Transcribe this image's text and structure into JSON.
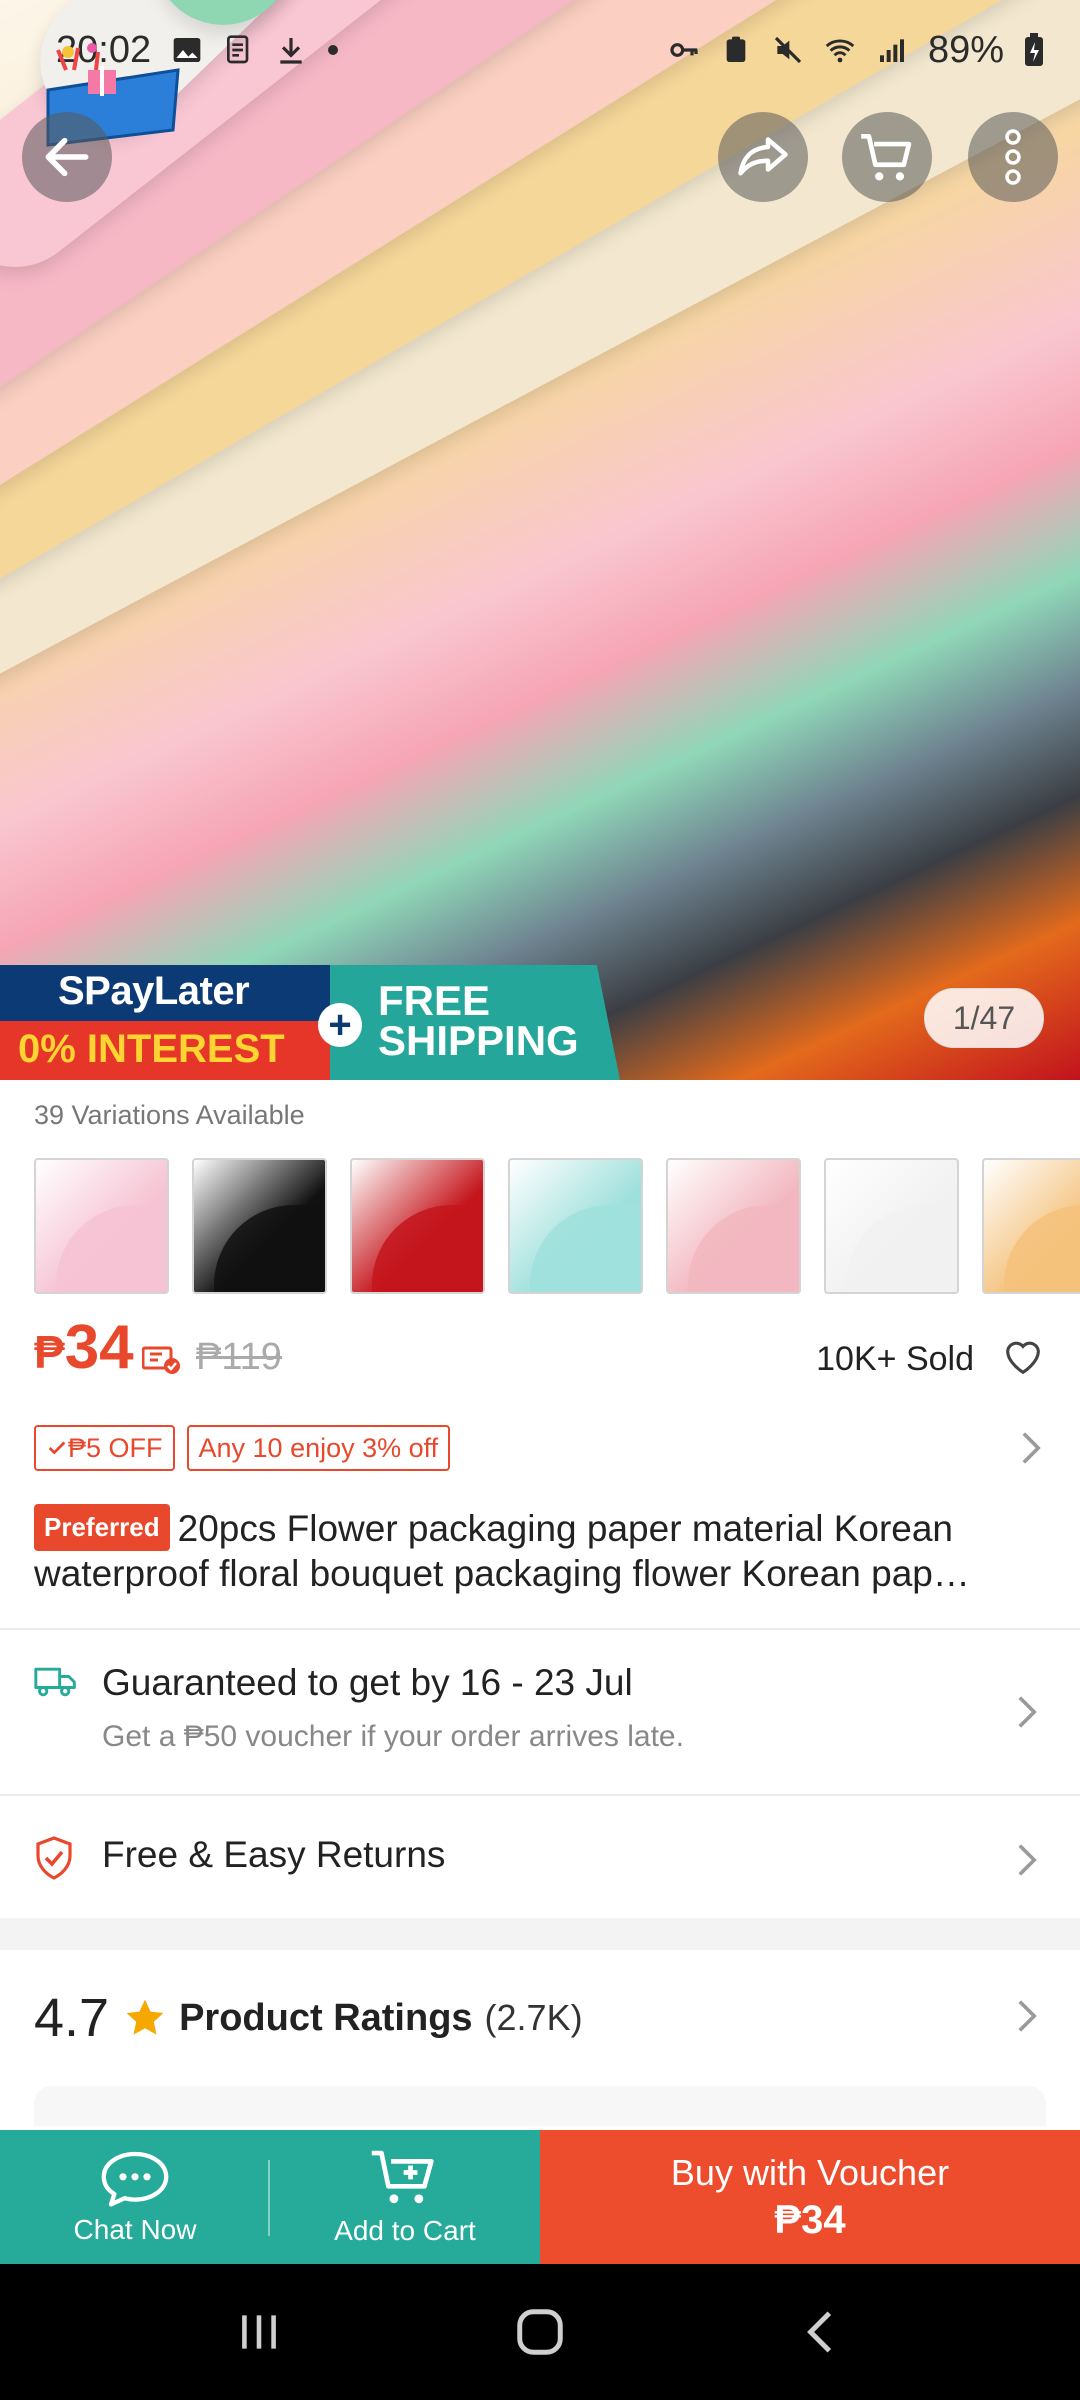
{
  "status_bar": {
    "time": "20:02",
    "battery": "89%"
  },
  "hero": {
    "image_counter": "1/47"
  },
  "promo": {
    "spaylater": "SPayLater",
    "interest": "0% INTEREST",
    "free": "FREE",
    "shipping": "SHIPPING"
  },
  "variations": {
    "label": "39 Variations Available",
    "swatches": [
      {
        "name": "pink",
        "color": "#f6c3d3"
      },
      {
        "name": "black",
        "color": "#111111"
      },
      {
        "name": "red",
        "color": "#c4151c"
      },
      {
        "name": "mint",
        "color": "#9fe0dc"
      },
      {
        "name": "rose",
        "color": "#f2b7bf"
      },
      {
        "name": "white",
        "color": "#f1f1f1"
      },
      {
        "name": "peach",
        "color": "#f4c27c"
      }
    ]
  },
  "price": {
    "currency": "₱",
    "amount": "34",
    "original": "₱119",
    "sold": "10K+ Sold"
  },
  "tags": {
    "discount": "₱5 OFF",
    "bundle": "Any 10 enjoy 3% off"
  },
  "product": {
    "badge": "Preferred",
    "title_line1": "20pcs Flower packaging paper material Korean",
    "title_line2": "waterproof floral bouquet packaging flower Korean pap…"
  },
  "shipping": {
    "title": "Guaranteed to get by 16 - 23 Jul",
    "subtitle": "Get a ₱50 voucher if your order arrives late."
  },
  "returns": {
    "title": "Free & Easy Returns"
  },
  "ratings": {
    "score": "4.7",
    "label": "Product Ratings",
    "count": "(2.7K)"
  },
  "bottom_bar": {
    "chat": "Chat Now",
    "cart": "Add to Cart",
    "buy_line1": "Buy with Voucher",
    "buy_line2": "₱34"
  },
  "colors": {
    "accent": "#ee4d2d",
    "teal": "#26aa99",
    "promo_blue": "#0b3a74"
  }
}
